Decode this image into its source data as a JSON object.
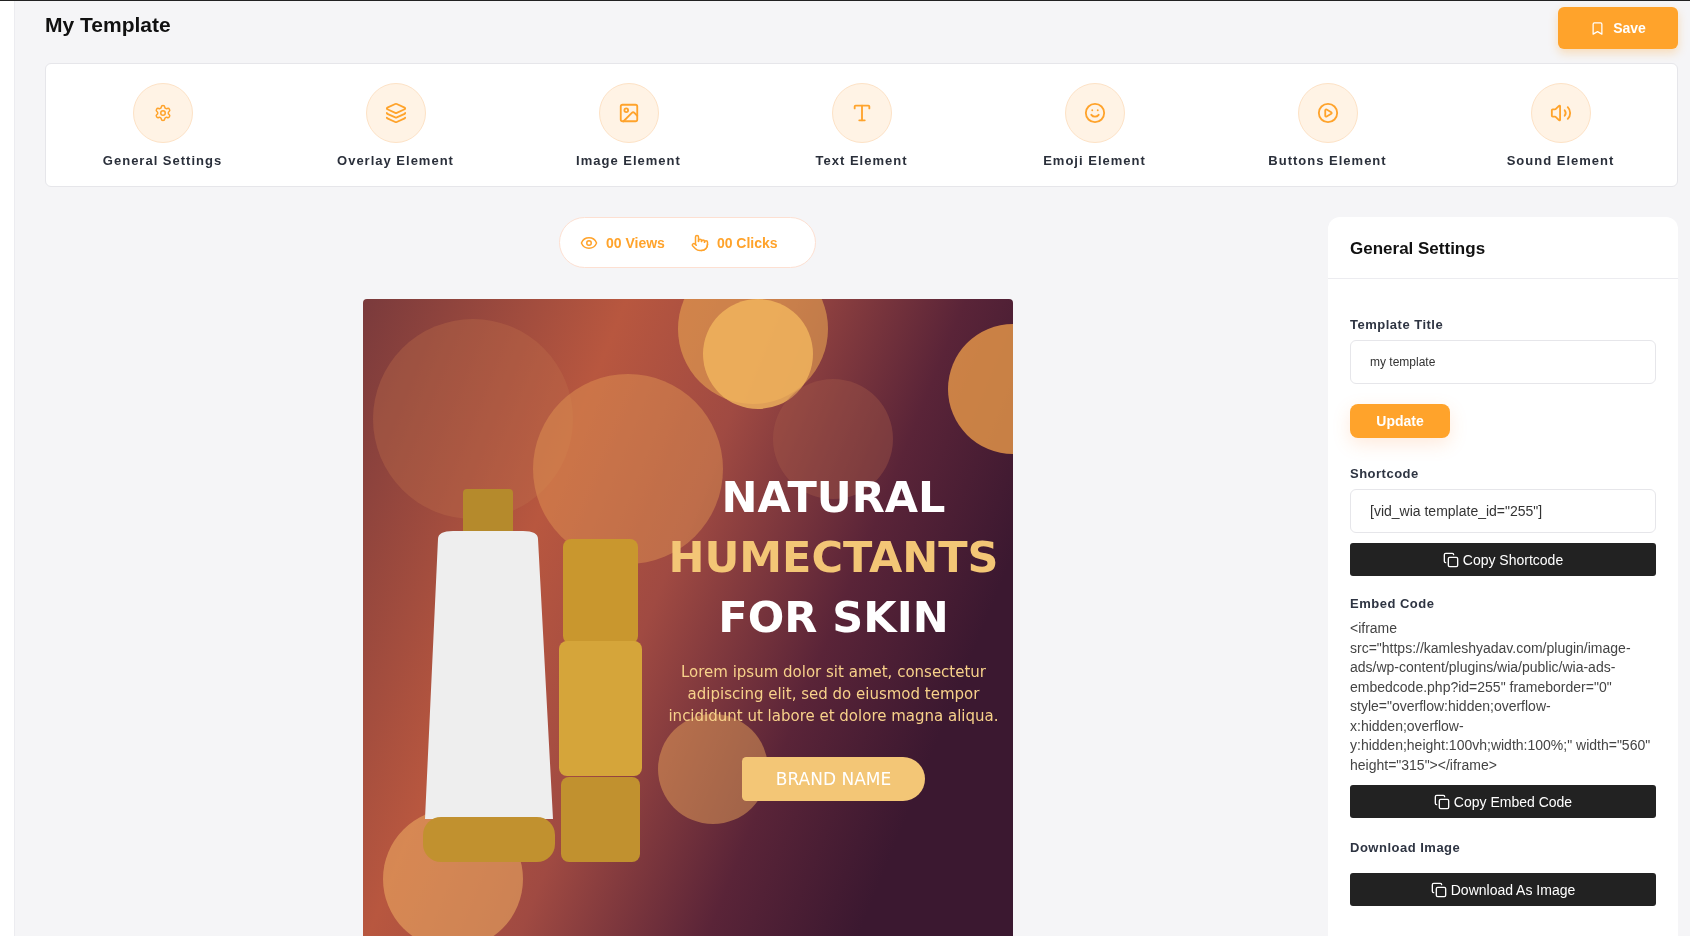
{
  "page": {
    "title": "My Template"
  },
  "save_button": {
    "label": "Save"
  },
  "toolbar": [
    {
      "kind": "settings",
      "label": "General Settings"
    },
    {
      "kind": "overlay",
      "label": "Overlay Element"
    },
    {
      "kind": "image",
      "label": "Image Element"
    },
    {
      "kind": "text",
      "label": "Text Element"
    },
    {
      "kind": "emoji",
      "label": "Emoji Element"
    },
    {
      "kind": "buttons",
      "label": "Buttons Element"
    },
    {
      "kind": "sound",
      "label": "Sound Element"
    }
  ],
  "stats": [
    {
      "kind": "views",
      "text": "00 Views"
    },
    {
      "kind": "clicks",
      "text": "00 Clicks"
    }
  ],
  "ad": {
    "headline": [
      {
        "text": "NATURAL",
        "color": "#ffffff"
      },
      {
        "text": "HUMECTANTS",
        "color": "#f3c676"
      },
      {
        "text": "FOR SKIN",
        "color": "#ffffff"
      }
    ],
    "body": "Lorem ipsum dolor sit amet, consectetur adipiscing elit, sed do eiusmod tempor incididunt ut labore et dolore magna aliqua.",
    "button": "BRAND NAME"
  },
  "settings_panel": {
    "title": "General Settings",
    "template_title": {
      "label": "Template Title",
      "value": "my template"
    },
    "update_button": "Update",
    "shortcode": {
      "label": "Shortcode",
      "value": "[vid_wia template_id=\"255\"]",
      "button": "Copy Shortcode"
    },
    "embed": {
      "label": "Embed Code",
      "code": "<iframe src=\"https://kamleshyadav.com/plugin/image-ads/wp-content/plugins/wia/public/wia-ads-embedcode.php?id=255\" frameborder=\"0\" style=\"overflow:hidden;overflow-x:hidden;overflow-y:hidden;height:100vh;width:100%;\" width=\"560\" height=\"315\"></iframe>",
      "button": "Copy Embed Code"
    },
    "download": {
      "label": "Download Image",
      "button": "Download As Image"
    }
  }
}
